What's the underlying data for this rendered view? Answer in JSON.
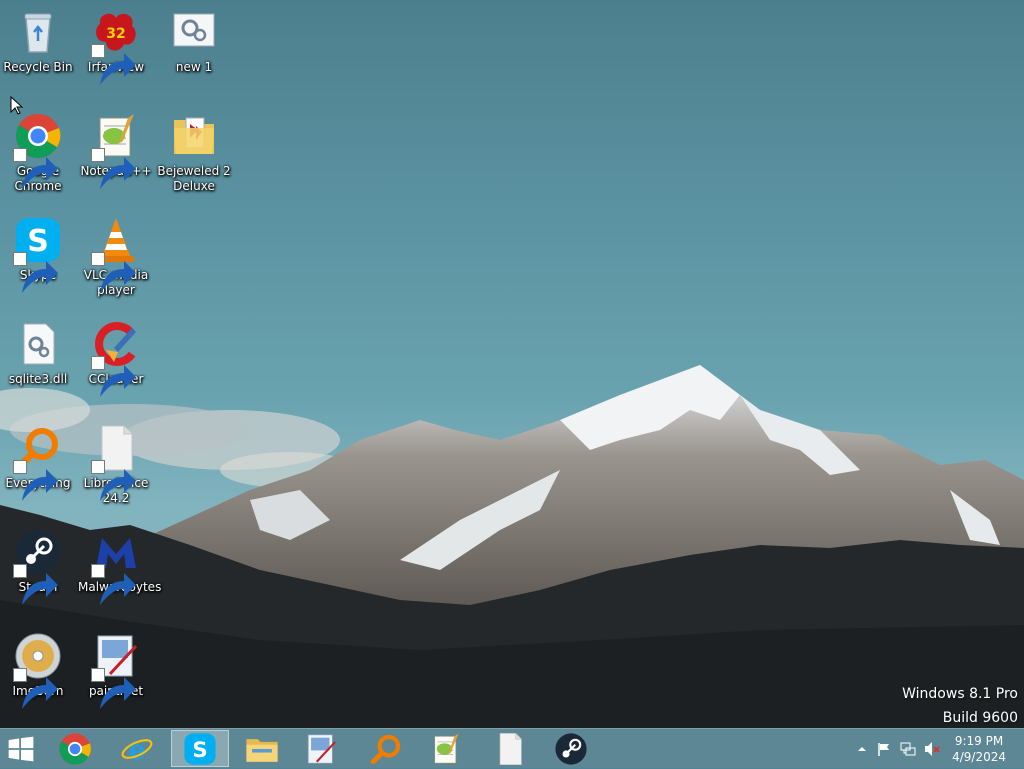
{
  "desktop": {
    "icons": [
      {
        "label": "Recycle Bin",
        "icon": "recycle-bin-icon",
        "shortcut": false
      },
      {
        "label": "IrfanView",
        "icon": "irfanview-icon",
        "shortcut": true,
        "badge": "32"
      },
      {
        "label": "new 1",
        "icon": "settings-file-icon",
        "shortcut": false
      },
      {
        "label": "Google\nChrome",
        "icon": "chrome-icon",
        "shortcut": true
      },
      {
        "label": "Notepad++",
        "icon": "notepadpp-icon",
        "shortcut": true
      },
      {
        "label": "Bejeweled 2\nDeluxe",
        "icon": "folder-icon",
        "shortcut": false
      },
      {
        "label": "Skype",
        "icon": "skype-icon",
        "shortcut": true
      },
      {
        "label": "VLC media\nplayer",
        "icon": "vlc-icon",
        "shortcut": true
      },
      {
        "label": "sqlite3.dll",
        "icon": "dll-file-icon",
        "shortcut": false
      },
      {
        "label": "CCleaner",
        "icon": "ccleaner-icon",
        "shortcut": true
      },
      {
        "label": "Everything",
        "icon": "everything-icon",
        "shortcut": true
      },
      {
        "label": "LibreOffice\n24.2",
        "icon": "libreoffice-icon",
        "shortcut": true
      },
      {
        "label": "Steam",
        "icon": "steam-icon",
        "shortcut": true
      },
      {
        "label": "Malwarebytes",
        "icon": "malwarebytes-icon",
        "shortcut": true
      },
      {
        "label": "ImgBurn",
        "icon": "imgburn-icon",
        "shortcut": true
      },
      {
        "label": "paint.net",
        "icon": "paintnet-icon",
        "shortcut": true
      }
    ],
    "watermark": {
      "line1": "Windows 8.1 Pro",
      "line2": "Build 9600"
    }
  },
  "taskbar": {
    "buttons": [
      {
        "name": "start-button",
        "icon": "windows-logo-icon"
      },
      {
        "name": "taskbar-chrome",
        "icon": "chrome-icon"
      },
      {
        "name": "taskbar-internet-explorer",
        "icon": "internet-explorer-icon"
      },
      {
        "name": "taskbar-skype",
        "icon": "skype-icon",
        "active": true
      },
      {
        "name": "taskbar-file-explorer",
        "icon": "file-explorer-icon"
      },
      {
        "name": "taskbar-paintnet",
        "icon": "paintnet-icon"
      },
      {
        "name": "taskbar-everything",
        "icon": "everything-icon"
      },
      {
        "name": "taskbar-notepadpp",
        "icon": "notepadpp-icon"
      },
      {
        "name": "taskbar-libreoffice",
        "icon": "libreoffice-icon"
      },
      {
        "name": "taskbar-steam",
        "icon": "steam-icon"
      }
    ],
    "tray": {
      "icons": [
        "show-hidden-icons-chevron-icon",
        "action-center-flag-icon",
        "network-icon",
        "volume-muted-icon"
      ],
      "time": "9:19 PM",
      "date": "4/9/2024"
    }
  },
  "colors": {
    "sky": "#5c93a2",
    "taskbar": "#5d8794",
    "label_text": "#ffffff"
  }
}
